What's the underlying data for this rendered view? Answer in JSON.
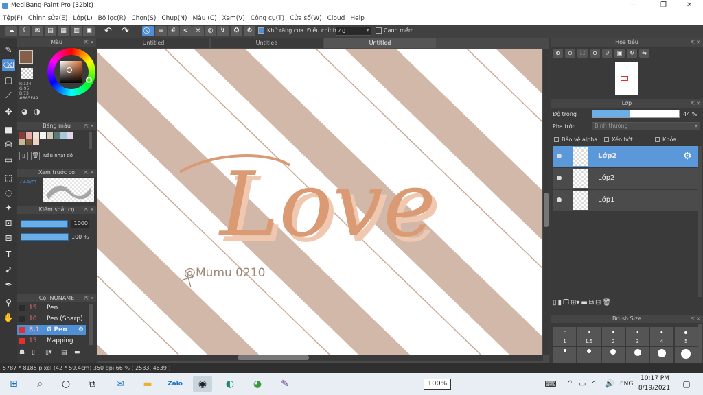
{
  "window": {
    "title": "MediBang Paint Pro (32bit)",
    "min": "—",
    "max": "❐",
    "close": "✕"
  },
  "menu": [
    "Tệp(F)",
    "Chỉnh sửa(E)",
    "Lớp(L)",
    "Bộ lọc(R)",
    "Chọn(S)",
    "Chụp(N)",
    "Màu (C)",
    "Xem(V)",
    "Công cụ(T)",
    "Cửa sổ(W)",
    "Cloud",
    "Help"
  ],
  "toolbar": {
    "antialias_label": "Khử răng cưa",
    "adjust_label": "Điều chỉnh",
    "adjust_value": "40",
    "edge_label": "Cạnh mềm",
    "undo_icon": "↶",
    "redo_icon": "↷"
  },
  "color_panel": {
    "title": "Màu",
    "rgb": [
      "R:134",
      "G:95",
      "B:73",
      "#865F49"
    ],
    "primary_color": "#865F49",
    "palette_title": "Bảng màu",
    "palette": [
      "#8b3a3a",
      "#e8a8a8",
      "#f0e0d0",
      "#f5f5f0",
      "#d0c8b8",
      "#5a7a7a",
      "#a8c8d8",
      "#e0d8e8",
      "#c8b898",
      "#7a5a3a",
      "#f0d0c0",
      "#3a3a3a"
    ],
    "palette_mode": "Nâu nhạt đỏ"
  },
  "preview_panel": {
    "title": "Xem trước cọ",
    "size": "72.5/m"
  },
  "brush_control": {
    "title": "Kiểm soát cọ",
    "size_value": "1000",
    "opacity_value": "100 %",
    "size_fill": 0.98,
    "opacity_fill": 1.0
  },
  "brush_panel": {
    "title": "Cọ: NONAME",
    "items": [
      {
        "size": "15",
        "name": "Pen",
        "color": "#2b2b2b",
        "selected": false
      },
      {
        "size": "10",
        "name": "Pen (Sharp)",
        "color": "#2b2b2b",
        "selected": false
      },
      {
        "size": "8.1",
        "name": "G Pen",
        "color": "#e03030",
        "selected": true
      },
      {
        "size": "15",
        "name": "Mapping Pen",
        "color": "#e03030",
        "selected": false
      }
    ]
  },
  "tabs": [
    "Untitled",
    "Untitled",
    "Untitled"
  ],
  "canvas": {
    "artwork_text": "Love",
    "signature": "@Mumu 0210",
    "stripe_color": "#d1b8a9",
    "line_color": "#c9a996"
  },
  "navigator": {
    "title": "Hoa tiêu"
  },
  "layer_panel": {
    "title": "Lớp",
    "opacity_label": "Độ trong",
    "opacity_value": "44 %",
    "opacity_fill": 0.44,
    "blend_label": "Pha trộn",
    "blend_value": "Bình thường",
    "protect_alpha": "Bảo vệ alpha",
    "clipping": "Xén bớt",
    "lock": "Khóa",
    "layers": [
      {
        "name": "Lớp2",
        "selected": true
      },
      {
        "name": "Lớp2",
        "selected": false
      },
      {
        "name": "Lớp1",
        "selected": false
      }
    ]
  },
  "brush_size_panel": {
    "title": "Brush Size",
    "sizes": [
      "1",
      "1.5",
      "2",
      "3",
      "4",
      "5"
    ]
  },
  "status": {
    "text": "5787 * 8185 pixel  (42 * 59.4cm)  350 dpi  66 %  ( 2533, 4639 )"
  },
  "taskbar": {
    "zoom": "100%",
    "lang": "ENG",
    "time": "10:17 PM",
    "date": "8/19/2021"
  }
}
